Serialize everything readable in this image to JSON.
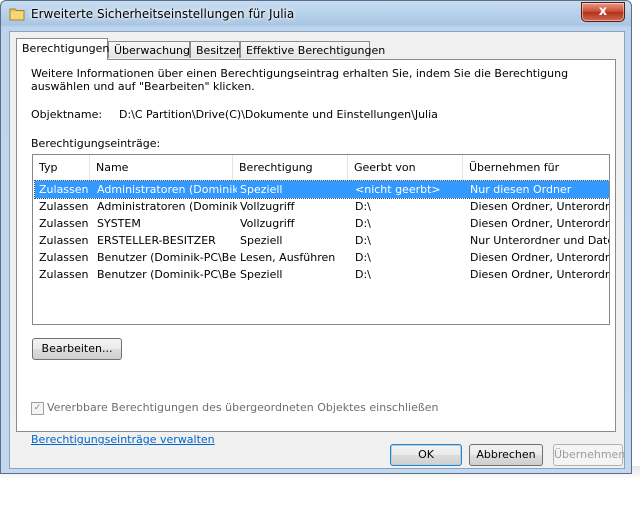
{
  "window": {
    "title": "Erweiterte Sicherheitseinstellungen für Julia",
    "close_glyph": "x"
  },
  "tabs": [
    {
      "label": "Berechtigungen",
      "active": true
    },
    {
      "label": "Überwachung",
      "active": false
    },
    {
      "label": "Besitzer",
      "active": false
    },
    {
      "label": "Effektive Berechtigungen",
      "active": false
    }
  ],
  "panel": {
    "info": "Weitere Informationen über einen Berechtigungseintrag erhalten Sie, indem Sie die Berechtigung auswählen und auf \"Bearbeiten\" klicken.",
    "object_label": "Objektname:",
    "object_value": "D:\\C Partition\\Drive(C)\\Dokumente und Einstellungen\\Julia",
    "entries_label": "Berechtigungseinträge:",
    "columns": [
      "Typ",
      "Name",
      "Berechtigung",
      "Geerbt von",
      "Übernehmen für"
    ],
    "rows": [
      [
        "Zulassen",
        "Administratoren (Dominik-...",
        "Speziell",
        "<nicht geerbt>",
        "Nur diesen Ordner"
      ],
      [
        "Zulassen",
        "Administratoren (Dominik-...",
        "Vollzugriff",
        "D:\\",
        "Diesen Ordner, Unterordn..."
      ],
      [
        "Zulassen",
        "SYSTEM",
        "Vollzugriff",
        "D:\\",
        "Diesen Ordner, Unterordn..."
      ],
      [
        "Zulassen",
        "ERSTELLER-BESITZER",
        "Speziell",
        "D:\\",
        "Nur Unterordner und Date..."
      ],
      [
        "Zulassen",
        "Benutzer (Dominik-PC\\Be...",
        "Lesen, Ausführen",
        "D:\\",
        "Diesen Ordner, Unterordn..."
      ],
      [
        "Zulassen",
        "Benutzer (Dominik-PC\\Be...",
        "Speziell",
        "D:\\",
        "Diesen Ordner, Unterordner"
      ]
    ],
    "selected_row": 0,
    "edit_button": "Bearbeiten...",
    "inherit_checkbox": {
      "label": "Vererbbare Berechtigungen des übergeordneten Objektes einschließen",
      "checked": true,
      "enabled": false
    },
    "manage_link": "Berechtigungseinträge verwalten"
  },
  "footer": {
    "ok": "OK",
    "cancel": "Abbrechen",
    "apply": "Übernehmen"
  }
}
